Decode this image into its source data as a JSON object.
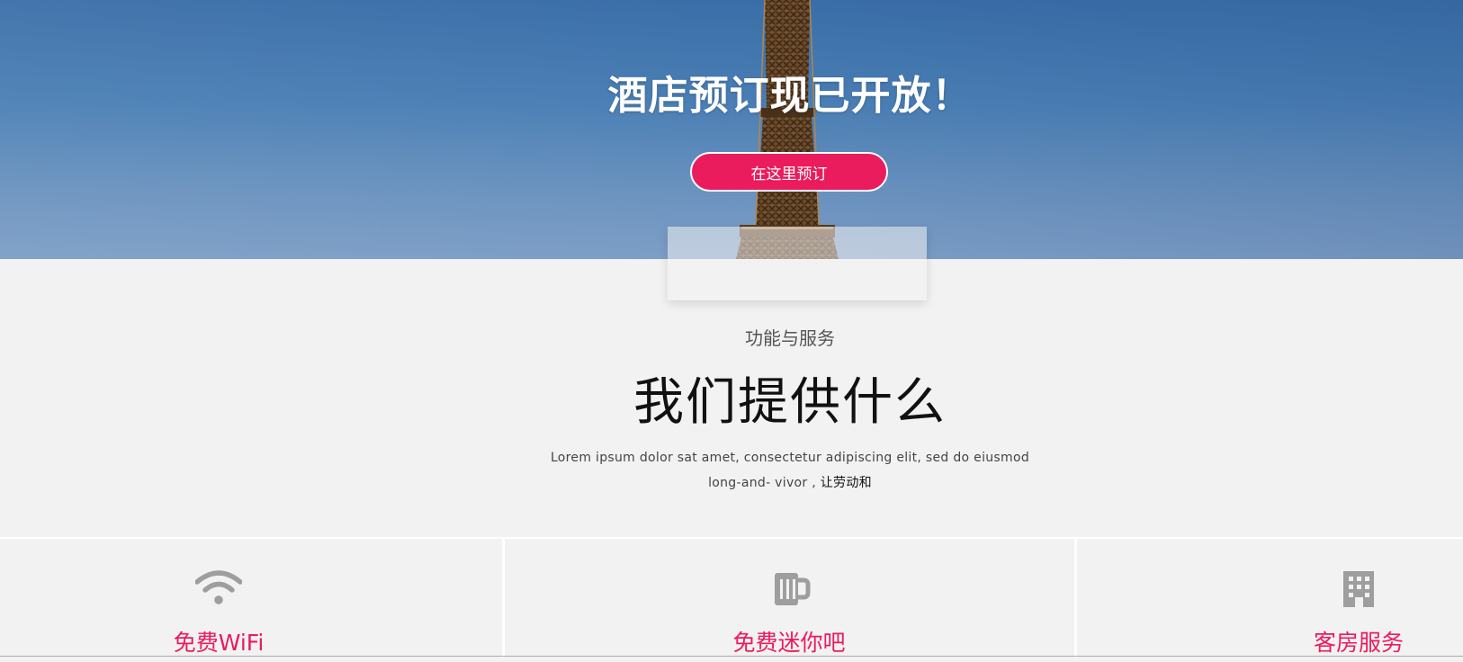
{
  "hero": {
    "title": "酒店预订现已开放！",
    "book_button_label": "在这里预订"
  },
  "section": {
    "subtitle": "功能与服务",
    "title": "我们提供什么",
    "description_line1": "Lorem ipsum dolor sat amet, consectetur adipiscing elit, sed do eiusmod",
    "description_line2_en": "long-and- vivor , ",
    "description_line2_cn": "让劳动和"
  },
  "features": [
    {
      "icon": "wifi-icon",
      "label": "免费WiFi"
    },
    {
      "icon": "mug-icon",
      "label": "免费迷你吧"
    },
    {
      "icon": "building-icon",
      "label": "客房服务"
    }
  ],
  "colors": {
    "accent": "#ea1c5d",
    "background": "#f2f2f2",
    "icon_gray": "#9e9e9e"
  }
}
